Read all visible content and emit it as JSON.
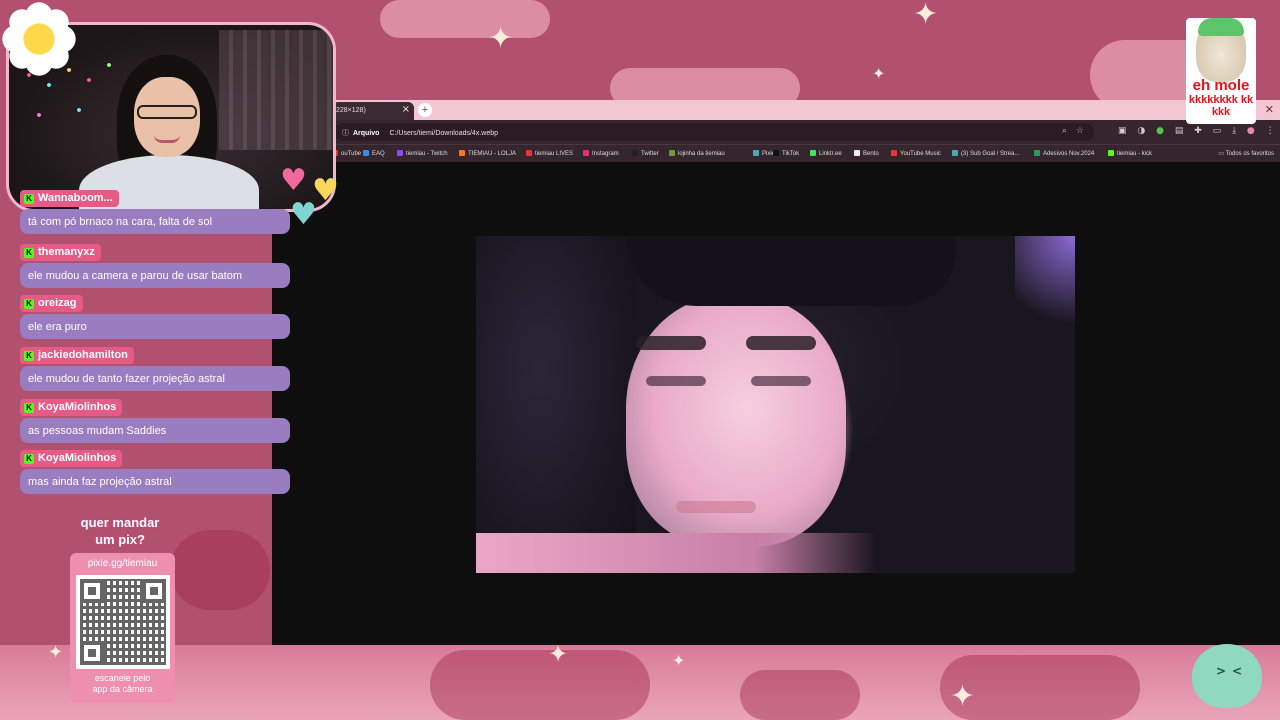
{
  "browser": {
    "tab_title": "228×128)",
    "address_chip": "Arquivo",
    "address_url": "C:/Users/tiemi/Downloads/4x.webp",
    "bookmarks": [
      {
        "label": "ouTube",
        "color": "#e33"
      },
      {
        "label": "EAQ",
        "color": "#3a8be0"
      },
      {
        "label": "tiemiau - Twitch",
        "color": "#9147ff"
      },
      {
        "label": "TIEMIAU - LOLJA",
        "color": "#f07a2a"
      },
      {
        "label": "tiemiau LIVES",
        "color": "#e33"
      },
      {
        "label": "Instagram",
        "color": "#e1306c"
      },
      {
        "label": "Twitter",
        "color": "#222"
      },
      {
        "label": "lojinha da tiemiau",
        "color": "#6b9b37"
      },
      {
        "label": "Pixie",
        "color": "#4ab"
      },
      {
        "label": "TikTok",
        "color": "#111"
      },
      {
        "label": "Linktr.ee",
        "color": "#43e55e"
      },
      {
        "label": "Bento",
        "color": "#eee"
      },
      {
        "label": "YouTube Music",
        "color": "#e33"
      },
      {
        "label": "(3) Sub Goal / Strea...",
        "color": "#4ab"
      },
      {
        "label": "Adesivos Nov.2024",
        "color": "#2d9d5a"
      },
      {
        "label": "tiemiau - kick",
        "color": "#53fc18"
      }
    ],
    "bookmarks_all": "Todos os favoritos"
  },
  "chat": {
    "messages": [
      {
        "user": "Wannaboom...",
        "text": "tá com pó brnaco na cara, falta de sol"
      },
      {
        "user": "themanyxz",
        "text": "ele mudou a camera e parou de usar batom"
      },
      {
        "user": "oreizag",
        "text": "ele era puro"
      },
      {
        "user": "jackiedohamilton",
        "text": "ele mudou de tanto fazer projeção astral"
      },
      {
        "user": "KoyaMiolinhos",
        "text": "as pessoas mudam Saddies"
      },
      {
        "user": "KoyaMiolinhos",
        "text": "mas ainda faz projeção astral"
      }
    ]
  },
  "pix": {
    "title_line1": "quer mandar",
    "title_line2": "um pix?",
    "url": "pixie.gg/tiemiau",
    "caption_line1": "escaneie pelo",
    "caption_line2": "app da câmera"
  },
  "sticker": {
    "line1": "eh mole",
    "line2": "kkkkkkkk kkkkk"
  },
  "colors": {
    "background": "#b2506f",
    "chat_user_bg": "#e65b86",
    "chat_text_bg": "#9a7cc0",
    "kick_green": "#53fc18"
  },
  "icons": [
    "search-icon",
    "star-icon",
    "close-icon",
    "plus-icon",
    "kick-icon",
    "info-icon",
    "folder-icon"
  ]
}
